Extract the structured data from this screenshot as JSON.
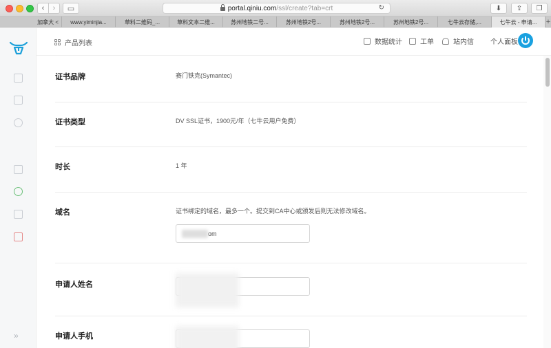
{
  "browser": {
    "url_host": "portal.qiniu.com",
    "url_path": "/ssl/create?tab=crt",
    "tabs": [
      {
        "label": "加拿大 <",
        "active": false
      },
      {
        "label": "www.yiminjia...",
        "active": false
      },
      {
        "label": "草料二维码_...",
        "active": false
      },
      {
        "label": "草料文本二维...",
        "active": false
      },
      {
        "label": "苏州地铁二号...",
        "active": false
      },
      {
        "label": "苏州地铁2号...",
        "active": false
      },
      {
        "label": "苏州地铁2号...",
        "active": false
      },
      {
        "label": "苏州地铁2号...",
        "active": false
      },
      {
        "label": "七牛云存储,...",
        "active": false
      },
      {
        "label": "七牛云 - 申请...",
        "active": true
      }
    ]
  },
  "topnav": {
    "product_list": "产品列表",
    "stats": "数据统计",
    "ticket": "工单",
    "messages": "站内信",
    "profile": "个人面板"
  },
  "form": {
    "brand": {
      "label": "证书品牌",
      "value": "赛门铁克(Symantec)"
    },
    "type": {
      "label": "证书类型",
      "value": "DV SSL证书，1900元/年（七牛云用户免费）"
    },
    "duration": {
      "label": "时长",
      "value": "1 年"
    },
    "domain": {
      "label": "域名",
      "hint": "证书绑定的域名，最多一个。提交到CA中心或颁发后则无法修改域名。",
      "value_suffix": "om"
    },
    "applicant_name": {
      "label": "申请人姓名"
    },
    "applicant_phone": {
      "label": "申请人手机"
    }
  },
  "colors": {
    "brand_blue": "#1aa1e0",
    "logo_blue": "#1a9fd9"
  }
}
